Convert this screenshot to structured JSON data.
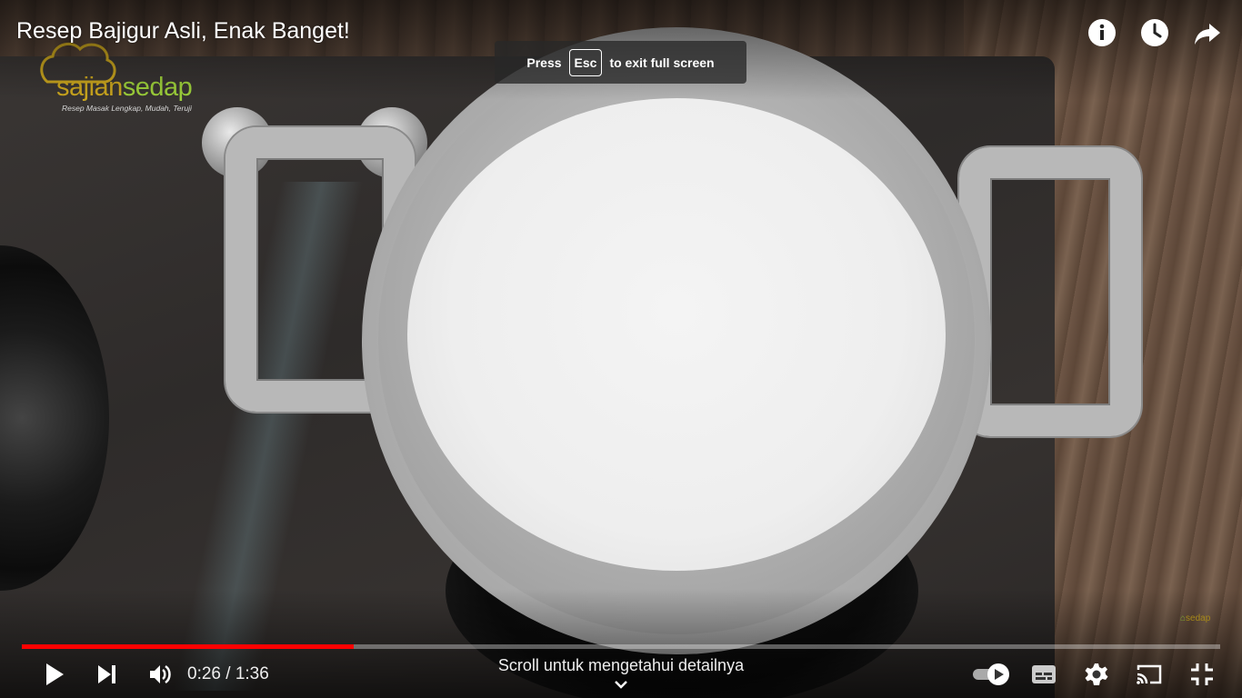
{
  "video": {
    "title": "Resep Bajigur Asli, Enak Banget!",
    "brand": {
      "name_part1": "sajian",
      "name_part2": "sedap",
      "tagline": "Resep Masak Lengkap, Mudah, Teruji",
      "watermark": "sedap"
    }
  },
  "top_bar": {
    "icons": [
      "info-icon",
      "watch-later-icon",
      "share-icon"
    ]
  },
  "fullscreen_toast": {
    "press": "Press",
    "key": "Esc",
    "suffix": "to exit full screen"
  },
  "player": {
    "progress_played_fraction": 0.277,
    "progress_loaded_fraction": 0.277,
    "current_time": "0:26",
    "separator": "/",
    "duration": "1:36",
    "scroll_hint": "Scroll untuk mengetahui detailnya",
    "colors": {
      "played": "#ff0000",
      "track": "rgba(255,255,255,0.35)"
    }
  },
  "controls": {
    "left": [
      "play-icon",
      "next-icon",
      "volume-icon"
    ],
    "right": [
      "autoplay-toggle",
      "subtitles-icon",
      "settings-icon",
      "cast-icon",
      "exit-fullscreen-icon"
    ]
  }
}
